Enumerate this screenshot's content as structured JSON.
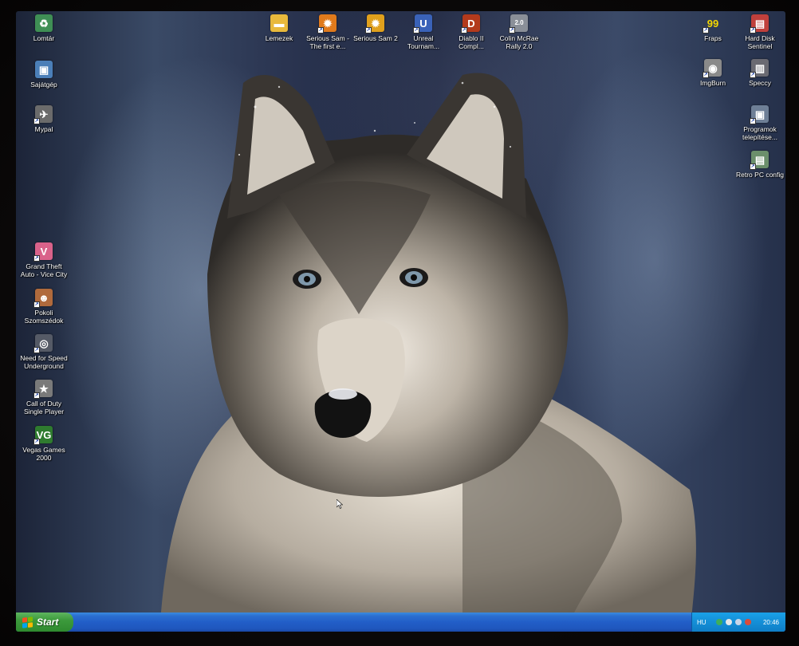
{
  "desktop": {
    "left_icons": [
      {
        "name": "lomtar-icon",
        "label": "Lomtár",
        "glyph": "♻",
        "color": "#3f8f55"
      },
      {
        "name": "sajatgep-icon",
        "label": "Sajátgép",
        "glyph": "▣",
        "color": "#4b7fb8"
      },
      {
        "name": "mypal-icon",
        "label": "Mypal",
        "glyph": "✈",
        "color": "#6b6b6b"
      },
      {
        "name": "gta-vice-city-icon",
        "label": "Grand Theft\nAuto - Vice City",
        "glyph": "V",
        "color": "#d9628a"
      },
      {
        "name": "pokoli-szomszedok-icon",
        "label": "Pokoli\nSzomszédok",
        "glyph": "☻",
        "color": "#b06a3c"
      },
      {
        "name": "need-for-speed-underground-icon",
        "label": "Need for Speed\nUnderground",
        "glyph": "◎",
        "color": "#555a66"
      },
      {
        "name": "call-of-duty-icon",
        "label": "Call of Duty\nSingle Player",
        "glyph": "★",
        "color": "#7a7a7a"
      },
      {
        "name": "vegas-games-2000-icon",
        "label": "Vegas Games\n2000",
        "glyph": "VG",
        "color": "#2f7b2f"
      }
    ],
    "top_icons": [
      {
        "name": "lemezek-folder-icon",
        "label": "Lemezek",
        "glyph": "▬",
        "color": "#e8b93c"
      },
      {
        "name": "serious-sam-first-icon",
        "label": "Serious Sam -\nThe first e...",
        "glyph": "✹",
        "color": "#e07a1c"
      },
      {
        "name": "serious-sam-2-icon",
        "label": "Serious Sam 2",
        "glyph": "✹",
        "color": "#e0a01c"
      },
      {
        "name": "unreal-tournament-icon",
        "label": "Unreal\nTournam...",
        "glyph": "U",
        "color": "#3a62b8"
      },
      {
        "name": "diablo-ii-icon",
        "label": "Diablo II\nCompl...",
        "glyph": "D",
        "color": "#b33a1c"
      },
      {
        "name": "colin-mcrae-rally-icon",
        "label": "Colin McRae\nRally 2.0",
        "glyph": "2.0",
        "color": "#8a8f98"
      }
    ],
    "right_icons": [
      {
        "name": "fraps-icon",
        "label": "Fraps",
        "glyph": "99",
        "color": "#1a1a1a"
      },
      {
        "name": "hard-disk-sentinel-icon",
        "label": "Hard Disk\nSentinel",
        "glyph": "▤",
        "color": "#c0403c"
      },
      {
        "name": "imgburn-icon",
        "label": "ImgBurn",
        "glyph": "◉",
        "color": "#8a8a8a"
      },
      {
        "name": "speccy-icon",
        "label": "Speccy",
        "glyph": "▥",
        "color": "#6a6a72"
      },
      {
        "name": "programok-telepitese-icon",
        "label": "Programok\ntelepítése...",
        "glyph": "▣",
        "color": "#6e7f96"
      },
      {
        "name": "retro-pc-config-icon",
        "label": "Retro PC config",
        "glyph": "▤",
        "color": "#6b8f6b"
      }
    ]
  },
  "taskbar": {
    "start_label": "Start",
    "language": "HU",
    "clock": "20:46"
  },
  "colors": {
    "taskbar_blue": "#225ec8",
    "start_green": "#3c9a3c",
    "tray_blue": "#1590d8"
  }
}
